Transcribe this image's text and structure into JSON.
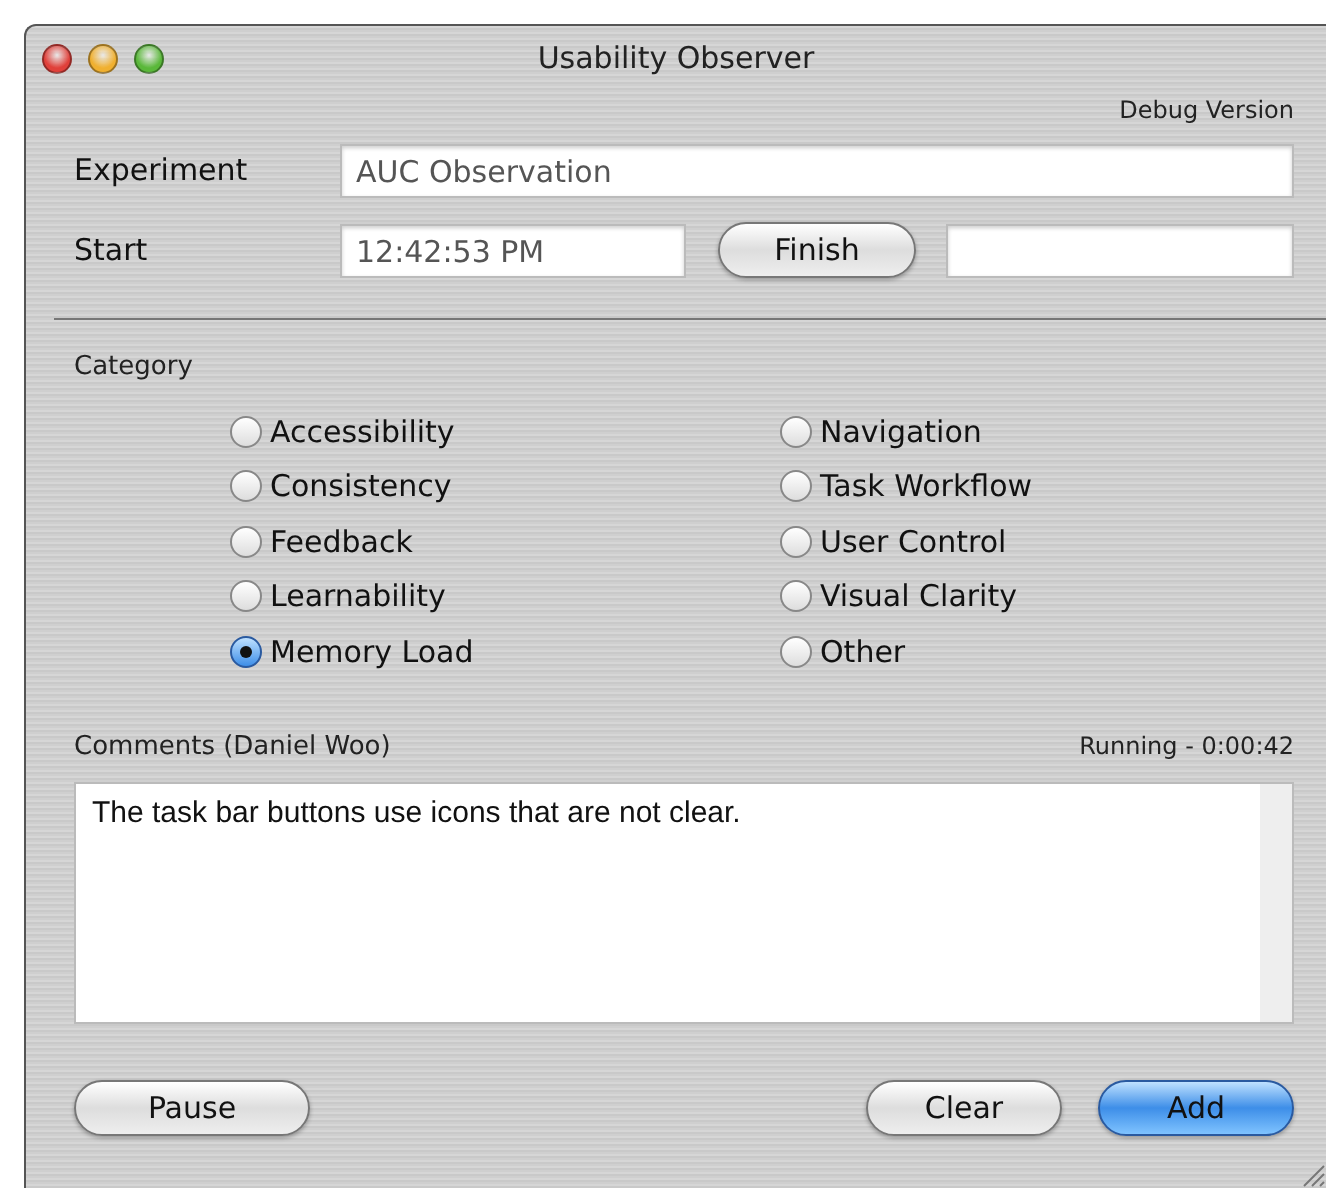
{
  "window": {
    "title": "Usability Observer"
  },
  "debug_label": "Debug Version",
  "experiment": {
    "label": "Experiment",
    "value": "AUC Observation"
  },
  "start": {
    "label": "Start",
    "value": "12:42:53 PM",
    "finish_button": "Finish"
  },
  "category": {
    "label": "Category",
    "options": [
      {
        "label": "Accessibility",
        "selected": false
      },
      {
        "label": "Consistency",
        "selected": false
      },
      {
        "label": "Feedback",
        "selected": false
      },
      {
        "label": "Learnability",
        "selected": false
      },
      {
        "label": "Memory Load",
        "selected": true
      },
      {
        "label": "Navigation",
        "selected": false
      },
      {
        "label": "Task Workflow",
        "selected": false
      },
      {
        "label": "User Control",
        "selected": false
      },
      {
        "label": "Visual Clarity",
        "selected": false
      },
      {
        "label": "Other",
        "selected": false
      }
    ]
  },
  "comments": {
    "label": "Comments (Daniel Woo)",
    "status": "Running - 0:00:42",
    "value": "The task bar buttons use icons that are not clear."
  },
  "left_buttons": [
    {
      "label": "Pause",
      "default": false
    }
  ],
  "right_buttons": [
    {
      "label": "Clear",
      "default": false
    },
    {
      "label": "Add",
      "default": true
    }
  ]
}
